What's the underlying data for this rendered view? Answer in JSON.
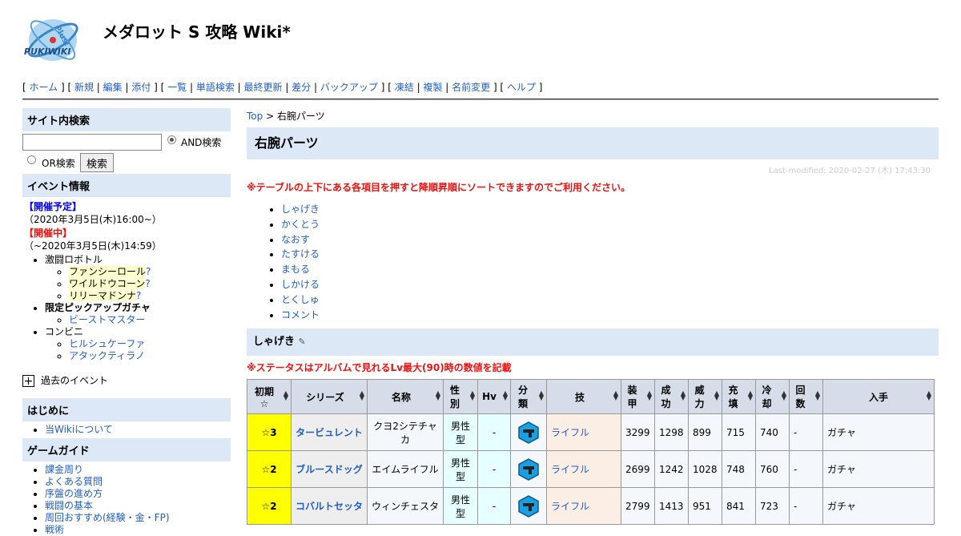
{
  "site": {
    "title": "メダロット S 攻略 Wiki*",
    "logo_text": "PUKIWIKI",
    "logo_plus": "Plus!"
  },
  "navbar": {
    "group1": [
      "ホーム",
      "新規",
      "編集",
      "添付"
    ],
    "group2": [
      "一覧",
      "単語検索",
      "最終更新",
      "差分",
      "バックアップ"
    ],
    "group3": [
      "凍結",
      "複製",
      "名前変更"
    ],
    "group4": [
      "ヘルプ"
    ]
  },
  "sidebar": {
    "search_heading": "サイト内検索",
    "search_value": "",
    "and_label": "AND検索",
    "or_label": "OR検索",
    "search_button": "検索",
    "event_heading": "イベント情報",
    "upcoming_label": "【開催予定】",
    "upcoming_date": "（2020年3月5日(木)16:00~）",
    "ongoing_label": "【開催中】",
    "ongoing_date": "（~2020年3月5日(木)14:59）",
    "events": [
      {
        "label": "激闘ロボトル",
        "bold": false,
        "children": [
          "ファンシーロール",
          "ワイルドウコーン",
          "リリーマドンナ"
        ],
        "highlight": true
      },
      {
        "label": "限定ピックアップガチャ",
        "bold": true,
        "children": [
          "ビーストマスター"
        ],
        "highlight": false
      },
      {
        "label": "コンビニ",
        "bold": false,
        "children": [
          "ヒルシュケーファ",
          "アタックティラノ"
        ],
        "highlight": false
      }
    ],
    "q_mark": "?",
    "past_events": "過去のイベント",
    "intro_heading": "はじめに",
    "intro_items": [
      "当Wikiについて"
    ],
    "guide_heading": "ゲームガイド",
    "guide_items": [
      "課金周り",
      "よくある質問",
      "序盤の進め方",
      "戦闘の基本",
      "周回おすすめ(経験・金・FP)",
      "戦術"
    ]
  },
  "main": {
    "breadcrumb_top": "Top",
    "breadcrumb_sep": " > ",
    "breadcrumb_current": "右腕パーツ",
    "page_title": "右腕パーツ",
    "last_modified": "Last-modified: 2020-02-27 (木) 17:43:30",
    "sort_note": "※テーブルの上下にある各項目を押すと降順昇順にソートできますのでご利用ください。",
    "toc": [
      "しゃげき",
      "かくとう",
      "なおす",
      "たすける",
      "まもる",
      "しかける",
      "とくしゅ",
      "コメント"
    ],
    "section_title": "しゃげき",
    "status_note": "※ステータスはアルバムで見れるLv最大(90)時の数値を記載"
  },
  "table": {
    "headers": [
      "初期☆",
      "シリーズ",
      "名称",
      "性別",
      "Hv",
      "分類",
      "技",
      "装甲",
      "成功",
      "威力",
      "充填",
      "冷却",
      "回数",
      "入手"
    ],
    "rows": [
      {
        "rarity": "☆3",
        "series": "タービュレント",
        "name": "クヨ2シテチャカ",
        "gender": "男性型",
        "hv": "-",
        "type_icon": "rifle-icon",
        "skill": "ライフル",
        "armor": "3299",
        "success": "1298",
        "power": "899",
        "charge": "715",
        "cool": "740",
        "count": "-",
        "obtain": "ガチャ"
      },
      {
        "rarity": "☆2",
        "series": "ブルースドッグ",
        "name": "エイムライフル",
        "gender": "男性型",
        "hv": "-",
        "type_icon": "rifle-icon",
        "skill": "ライフル",
        "armor": "2699",
        "success": "1242",
        "power": "1028",
        "charge": "748",
        "cool": "760",
        "count": "-",
        "obtain": "ガチャ"
      },
      {
        "rarity": "☆2",
        "series": "コバルトセッタ",
        "name": "ウィンチェスタ",
        "gender": "男性型",
        "hv": "-",
        "type_icon": "rifle-icon",
        "skill": "ライフル",
        "armor": "2799",
        "success": "1413",
        "power": "951",
        "charge": "841",
        "cool": "723",
        "count": "-",
        "obtain": "ガチャ"
      }
    ]
  },
  "colors": {
    "link": "#215dc6",
    "heading_bg": "#dde8f7",
    "note_red": "#ee1111",
    "rarity_yellow": "#ffff00"
  }
}
